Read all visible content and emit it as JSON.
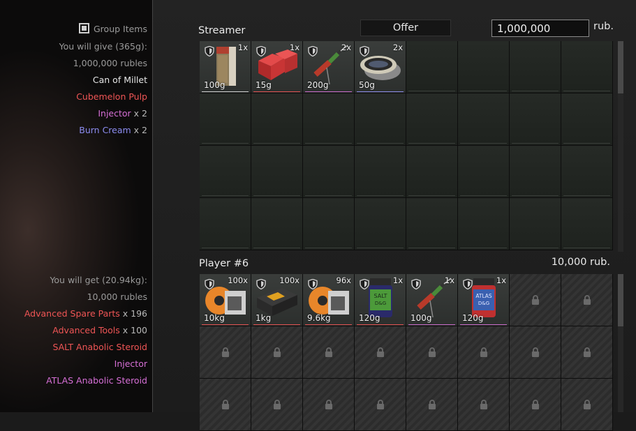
{
  "left": {
    "group_items": "Group Items",
    "give": {
      "header": "You will give (365g):",
      "rubles": "1,000,000 rubles",
      "items": [
        {
          "name": "Can of Millet",
          "mult": "",
          "color": "#e6e6e6"
        },
        {
          "name": "Cubemelon Pulp",
          "mult": "",
          "color": "#ef5555"
        },
        {
          "name": "Injector",
          "mult": " x 2",
          "color": "#d66fd6"
        },
        {
          "name": "Burn Cream",
          "mult": " x 2",
          "color": "#8c8cf0"
        }
      ]
    },
    "get": {
      "header": "You will get (20.94kg):",
      "rubles": "10,000 rubles",
      "items": [
        {
          "name": "Advanced Spare Parts",
          "mult": " x 196",
          "color": "#ef5555"
        },
        {
          "name": "Advanced Tools",
          "mult": " x 100",
          "color": "#ef5555"
        },
        {
          "name": "SALT Anabolic Steroid",
          "mult": "",
          "color": "#ef5555"
        },
        {
          "name": "Injector",
          "mult": "",
          "color": "#d66fd6"
        },
        {
          "name": "ATLAS Anabolic Steroid",
          "mult": "",
          "color": "#d66fd6"
        }
      ]
    }
  },
  "streamer": {
    "title": "Streamer",
    "offer_label": "Offer",
    "offer_value": "1,000,000",
    "rub_label": "rub.",
    "items": [
      {
        "qty": "1x",
        "weight": "100g",
        "icon": "can-icon",
        "rarity": "#cfcfcf"
      },
      {
        "qty": "1x",
        "weight": "15g",
        "icon": "red-cubes-icon",
        "rarity": "#e05050"
      },
      {
        "qty": "2x",
        "weight": "200g",
        "icon": "injector-icon",
        "rarity": "#c86ac8"
      },
      {
        "qty": "2x",
        "weight": "50g",
        "icon": "cream-tin-icon",
        "rarity": "#8a8ae8"
      }
    ]
  },
  "player": {
    "title": "Player #6",
    "total": "10,000 rub.",
    "items": [
      {
        "qty": "100x",
        "weight": "10kg",
        "icon": "spare-parts-icon",
        "rarity": "#e05050"
      },
      {
        "qty": "100x",
        "weight": "1kg",
        "icon": "toolbox-icon",
        "rarity": "#e05050"
      },
      {
        "qty": "96x",
        "weight": "9.6kg",
        "icon": "spare-parts-icon",
        "rarity": "#e05050"
      },
      {
        "qty": "1x",
        "weight": "120g",
        "icon": "salt-jar-icon",
        "rarity": "#e05050"
      },
      {
        "qty": "1x",
        "weight": "100g",
        "icon": "injector-icon",
        "rarity": "#c86ac8"
      },
      {
        "qty": "1x",
        "weight": "120g",
        "icon": "atlas-jar-icon",
        "rarity": "#c86ac8"
      }
    ],
    "jar_labels": {
      "salt": "SALT D&G",
      "atlas": "ATLAS D&G"
    }
  }
}
